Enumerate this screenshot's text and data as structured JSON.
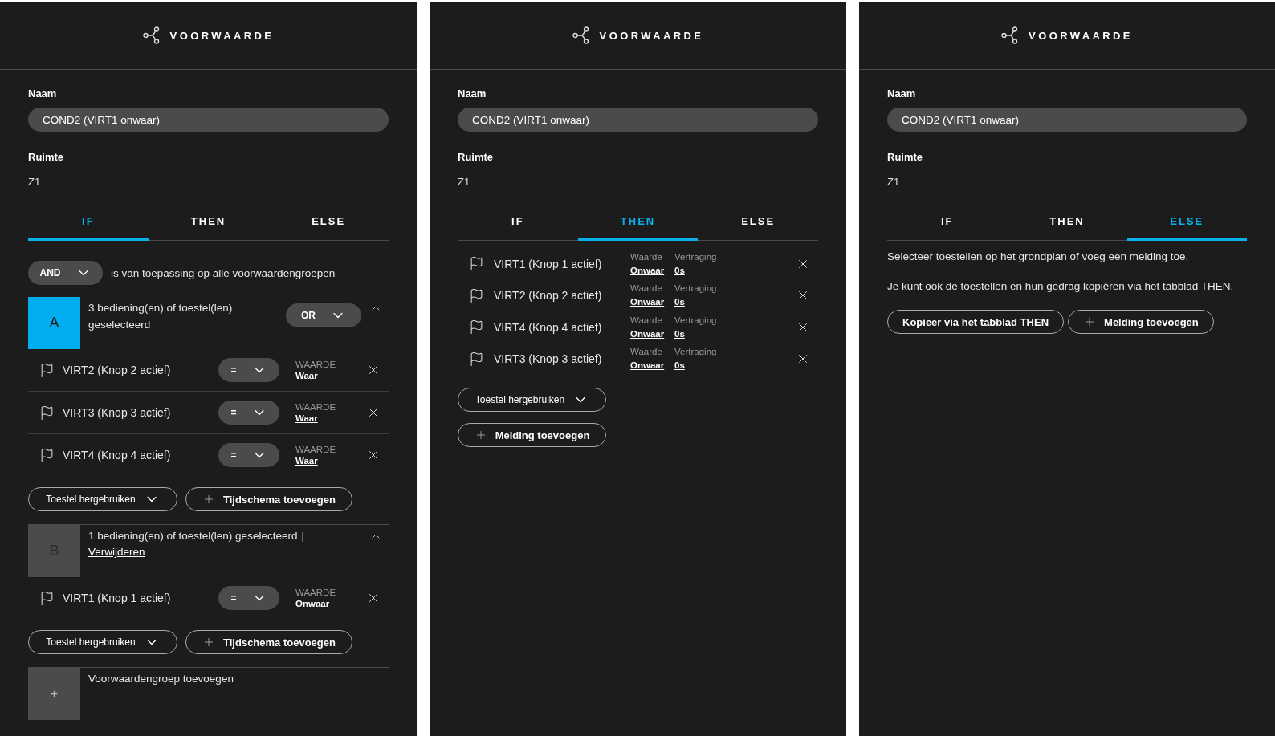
{
  "panels": [
    {
      "title": "VOORWAARDE",
      "name_label": "Naam",
      "name_value": "COND2 (VIRT1 onwaar)",
      "room_label": "Ruimte",
      "room_value": "Z1",
      "tabs": [
        {
          "label": "IF",
          "selected": true
        },
        {
          "label": "THEN",
          "selected": false
        },
        {
          "label": "ELSE",
          "selected": false
        }
      ],
      "content": {
        "kind": "if",
        "operator": "AND",
        "operator_text": "is van toepassing op alle voorwaardengroepen",
        "groups": [
          {
            "letter": "A",
            "selected": true,
            "summary": "3 bediening(en) of toestel(len) geselecteerd",
            "operator": "OR",
            "rows": [
              {
                "device": "VIRT2 (Knop 2 actief)",
                "op": "=",
                "value_label": "WAARDE",
                "value": "Waar"
              },
              {
                "device": "VIRT3 (Knop 3 actief)",
                "op": "=",
                "value_label": "WAARDE",
                "value": "Waar"
              },
              {
                "device": "VIRT4 (Knop 4 actief)",
                "op": "=",
                "value_label": "WAARDE",
                "value": "Waar"
              }
            ],
            "reuse_button": "Toestel hergebruiken",
            "schedule_button": "Tijdschema toevoegen"
          },
          {
            "letter": "B",
            "selected": false,
            "summary": "1 bediening(en) of toestel(len) geselecteerd",
            "separator": "|",
            "remove_link": "Verwijderen",
            "rows": [
              {
                "device": "VIRT1 (Knop 1 actief)",
                "op": "=",
                "value_label": "WAARDE",
                "value": "Onwaar"
              }
            ],
            "reuse_button": "Toestel hergebruiken",
            "schedule_button": "Tijdschema toevoegen"
          }
        ],
        "add_group": {
          "symbol": "+",
          "label": "Voorwaardengroep toevoegen"
        }
      }
    },
    {
      "title": "VOORWAARDE",
      "name_label": "Naam",
      "name_value": "COND2 (VIRT1 onwaar)",
      "room_label": "Ruimte",
      "room_value": "Z1",
      "tabs": [
        {
          "label": "IF",
          "selected": false
        },
        {
          "label": "THEN",
          "selected": true
        },
        {
          "label": "ELSE",
          "selected": false
        }
      ],
      "content": {
        "kind": "then",
        "rows": [
          {
            "device": "VIRT1 (Knop 1 actief)",
            "value_label": "Waarde",
            "value": "Onwaar",
            "delay_label": "Vertraging",
            "delay": "0s"
          },
          {
            "device": "VIRT2 (Knop 2 actief)",
            "value_label": "Waarde",
            "value": "Onwaar",
            "delay_label": "Vertraging",
            "delay": "0s"
          },
          {
            "device": "VIRT4 (Knop 4 actief)",
            "value_label": "Waarde",
            "value": "Onwaar",
            "delay_label": "Vertraging",
            "delay": "0s"
          },
          {
            "device": "VIRT3 (Knop 3 actief)",
            "value_label": "Waarde",
            "value": "Onwaar",
            "delay_label": "Vertraging",
            "delay": "0s"
          }
        ],
        "reuse_button": "Toestel hergebruiken",
        "add_button": "Melding toevoegen"
      }
    },
    {
      "title": "VOORWAARDE",
      "name_label": "Naam",
      "name_value": "COND2 (VIRT1 onwaar)",
      "room_label": "Ruimte",
      "room_value": "Z1",
      "tabs": [
        {
          "label": "IF",
          "selected": false
        },
        {
          "label": "THEN",
          "selected": false
        },
        {
          "label": "ELSE",
          "selected": true
        }
      ],
      "content": {
        "kind": "else",
        "paragraphs": [
          "Selecteer toestellen op het grondplan of voeg een melding toe.",
          "Je kunt ook de toestellen en hun gedrag kopiëren via het tabblad THEN."
        ],
        "buttons": [
          {
            "kind": "plain",
            "label": "Kopieer via het tabblad THEN"
          },
          {
            "kind": "add",
            "label": "Melding toevoegen"
          }
        ]
      }
    }
  ]
}
